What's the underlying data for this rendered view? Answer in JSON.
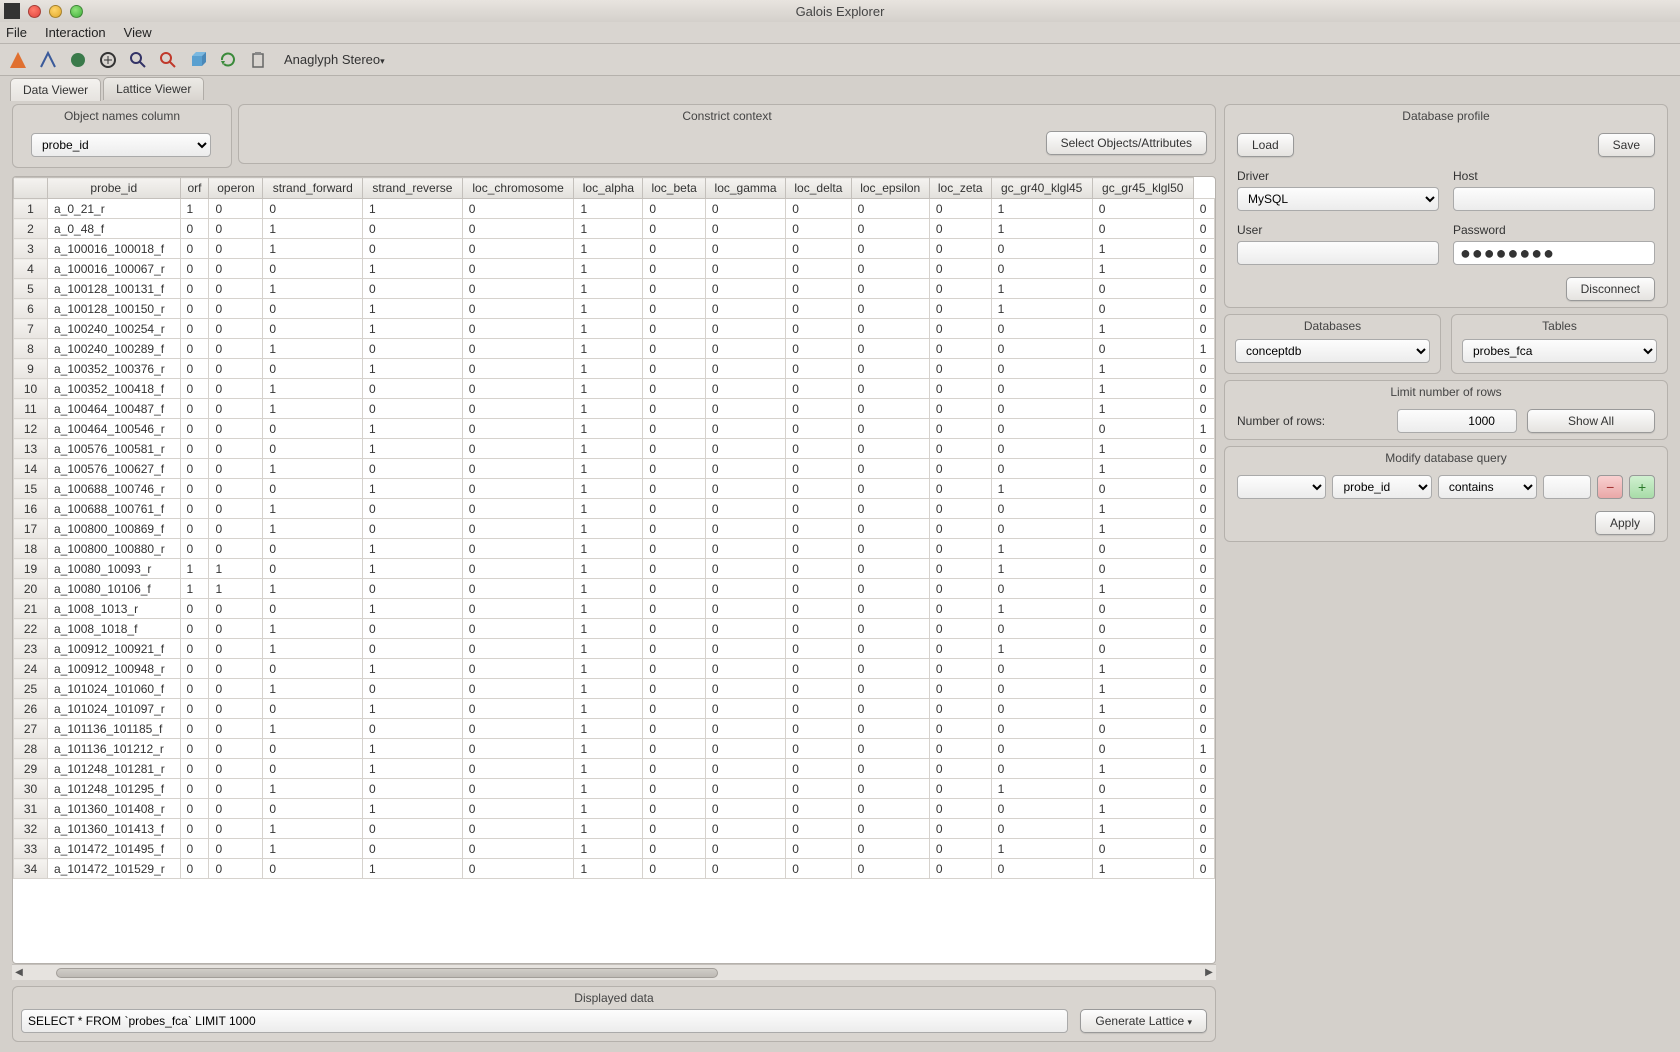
{
  "app": {
    "title": "Galois Explorer"
  },
  "menu": {
    "file": "File",
    "interaction": "Interaction",
    "view": "View"
  },
  "toolbar": {
    "stereo": "Anaglyph Stereo"
  },
  "tabs": {
    "data": "Data Viewer",
    "lattice": "Lattice Viewer"
  },
  "objcol": {
    "title": "Object names column",
    "value": "probe_id"
  },
  "constrict": {
    "title": "Constrict context",
    "select_btn": "Select Objects/Attributes"
  },
  "table": {
    "headers": [
      "probe_id",
      "orf",
      "operon",
      "strand_forward",
      "strand_reverse",
      "loc_chromosome",
      "loc_alpha",
      "loc_beta",
      "loc_gamma",
      "loc_delta",
      "loc_epsilon",
      "loc_zeta",
      "gc_gr40_klgl45",
      "gc_gr45_klgl50"
    ],
    "rows": [
      [
        "a_0_21_r",
        "1",
        "0",
        "0",
        "1",
        "0",
        "1",
        "0",
        "0",
        "0",
        "0",
        "0",
        "1",
        "0",
        "0"
      ],
      [
        "a_0_48_f",
        "0",
        "0",
        "1",
        "0",
        "0",
        "1",
        "0",
        "0",
        "0",
        "0",
        "0",
        "1",
        "0",
        "0"
      ],
      [
        "a_100016_100018_f",
        "0",
        "0",
        "1",
        "0",
        "0",
        "1",
        "0",
        "0",
        "0",
        "0",
        "0",
        "0",
        "1",
        "0"
      ],
      [
        "a_100016_100067_r",
        "0",
        "0",
        "0",
        "1",
        "0",
        "1",
        "0",
        "0",
        "0",
        "0",
        "0",
        "0",
        "1",
        "0"
      ],
      [
        "a_100128_100131_f",
        "0",
        "0",
        "1",
        "0",
        "0",
        "1",
        "0",
        "0",
        "0",
        "0",
        "0",
        "1",
        "0",
        "0"
      ],
      [
        "a_100128_100150_r",
        "0",
        "0",
        "0",
        "1",
        "0",
        "1",
        "0",
        "0",
        "0",
        "0",
        "0",
        "1",
        "0",
        "0"
      ],
      [
        "a_100240_100254_r",
        "0",
        "0",
        "0",
        "1",
        "0",
        "1",
        "0",
        "0",
        "0",
        "0",
        "0",
        "0",
        "1",
        "0"
      ],
      [
        "a_100240_100289_f",
        "0",
        "0",
        "1",
        "0",
        "0",
        "1",
        "0",
        "0",
        "0",
        "0",
        "0",
        "0",
        "0",
        "1"
      ],
      [
        "a_100352_100376_r",
        "0",
        "0",
        "0",
        "1",
        "0",
        "1",
        "0",
        "0",
        "0",
        "0",
        "0",
        "0",
        "1",
        "0"
      ],
      [
        "a_100352_100418_f",
        "0",
        "0",
        "1",
        "0",
        "0",
        "1",
        "0",
        "0",
        "0",
        "0",
        "0",
        "0",
        "1",
        "0"
      ],
      [
        "a_100464_100487_f",
        "0",
        "0",
        "1",
        "0",
        "0",
        "1",
        "0",
        "0",
        "0",
        "0",
        "0",
        "0",
        "1",
        "0"
      ],
      [
        "a_100464_100546_r",
        "0",
        "0",
        "0",
        "1",
        "0",
        "1",
        "0",
        "0",
        "0",
        "0",
        "0",
        "0",
        "0",
        "1"
      ],
      [
        "a_100576_100581_r",
        "0",
        "0",
        "0",
        "1",
        "0",
        "1",
        "0",
        "0",
        "0",
        "0",
        "0",
        "0",
        "1",
        "0"
      ],
      [
        "a_100576_100627_f",
        "0",
        "0",
        "1",
        "0",
        "0",
        "1",
        "0",
        "0",
        "0",
        "0",
        "0",
        "0",
        "1",
        "0"
      ],
      [
        "a_100688_100746_r",
        "0",
        "0",
        "0",
        "1",
        "0",
        "1",
        "0",
        "0",
        "0",
        "0",
        "0",
        "1",
        "0",
        "0"
      ],
      [
        "a_100688_100761_f",
        "0",
        "0",
        "1",
        "0",
        "0",
        "1",
        "0",
        "0",
        "0",
        "0",
        "0",
        "0",
        "1",
        "0"
      ],
      [
        "a_100800_100869_f",
        "0",
        "0",
        "1",
        "0",
        "0",
        "1",
        "0",
        "0",
        "0",
        "0",
        "0",
        "0",
        "1",
        "0"
      ],
      [
        "a_100800_100880_r",
        "0",
        "0",
        "0",
        "1",
        "0",
        "1",
        "0",
        "0",
        "0",
        "0",
        "0",
        "1",
        "0",
        "0"
      ],
      [
        "a_10080_10093_r",
        "1",
        "1",
        "0",
        "1",
        "0",
        "1",
        "0",
        "0",
        "0",
        "0",
        "0",
        "1",
        "0",
        "0"
      ],
      [
        "a_10080_10106_f",
        "1",
        "1",
        "1",
        "0",
        "0",
        "1",
        "0",
        "0",
        "0",
        "0",
        "0",
        "0",
        "1",
        "0"
      ],
      [
        "a_1008_1013_r",
        "0",
        "0",
        "0",
        "1",
        "0",
        "1",
        "0",
        "0",
        "0",
        "0",
        "0",
        "1",
        "0",
        "0"
      ],
      [
        "a_1008_1018_f",
        "0",
        "0",
        "1",
        "0",
        "0",
        "1",
        "0",
        "0",
        "0",
        "0",
        "0",
        "0",
        "0",
        "0"
      ],
      [
        "a_100912_100921_f",
        "0",
        "0",
        "1",
        "0",
        "0",
        "1",
        "0",
        "0",
        "0",
        "0",
        "0",
        "1",
        "0",
        "0"
      ],
      [
        "a_100912_100948_r",
        "0",
        "0",
        "0",
        "1",
        "0",
        "1",
        "0",
        "0",
        "0",
        "0",
        "0",
        "0",
        "1",
        "0"
      ],
      [
        "a_101024_101060_f",
        "0",
        "0",
        "1",
        "0",
        "0",
        "1",
        "0",
        "0",
        "0",
        "0",
        "0",
        "0",
        "1",
        "0"
      ],
      [
        "a_101024_101097_r",
        "0",
        "0",
        "0",
        "1",
        "0",
        "1",
        "0",
        "0",
        "0",
        "0",
        "0",
        "0",
        "1",
        "0"
      ],
      [
        "a_101136_101185_f",
        "0",
        "0",
        "1",
        "0",
        "0",
        "1",
        "0",
        "0",
        "0",
        "0",
        "0",
        "0",
        "0",
        "0"
      ],
      [
        "a_101136_101212_r",
        "0",
        "0",
        "0",
        "1",
        "0",
        "1",
        "0",
        "0",
        "0",
        "0",
        "0",
        "0",
        "0",
        "1"
      ],
      [
        "a_101248_101281_r",
        "0",
        "0",
        "0",
        "1",
        "0",
        "1",
        "0",
        "0",
        "0",
        "0",
        "0",
        "0",
        "1",
        "0"
      ],
      [
        "a_101248_101295_f",
        "0",
        "0",
        "1",
        "0",
        "0",
        "1",
        "0",
        "0",
        "0",
        "0",
        "0",
        "1",
        "0",
        "0"
      ],
      [
        "a_101360_101408_r",
        "0",
        "0",
        "0",
        "1",
        "0",
        "1",
        "0",
        "0",
        "0",
        "0",
        "0",
        "0",
        "1",
        "0"
      ],
      [
        "a_101360_101413_f",
        "0",
        "0",
        "1",
        "0",
        "0",
        "1",
        "0",
        "0",
        "0",
        "0",
        "0",
        "0",
        "1",
        "0"
      ],
      [
        "a_101472_101495_f",
        "0",
        "0",
        "1",
        "0",
        "0",
        "1",
        "0",
        "0",
        "0",
        "0",
        "0",
        "1",
        "0",
        "0"
      ],
      [
        "a_101472_101529_r",
        "0",
        "0",
        "0",
        "1",
        "0",
        "1",
        "0",
        "0",
        "0",
        "0",
        "0",
        "0",
        "1",
        "0"
      ]
    ]
  },
  "displayed": {
    "title": "Displayed data",
    "query": "SELECT * FROM `probes_fca` LIMIT 1000"
  },
  "generate": "Generate Lattice",
  "db": {
    "title": "Database profile",
    "load": "Load",
    "save": "Save",
    "driver_label": "Driver",
    "driver": "MySQL",
    "host_label": "Host",
    "host": "",
    "user_label": "User",
    "user": "",
    "password_label": "Password",
    "password": "●●●●●●●●",
    "disconnect": "Disconnect",
    "databases_label": "Databases",
    "database": "conceptdb",
    "tables_label": "Tables",
    "table": "probes_fca",
    "limit_title": "Limit number of rows",
    "numrows_label": "Number of rows:",
    "numrows": "1000",
    "showall": "Show All",
    "modify_title": "Modify database query",
    "filter_col": "probe_id",
    "filter_op": "contains",
    "filter_val": "",
    "apply": "Apply"
  }
}
